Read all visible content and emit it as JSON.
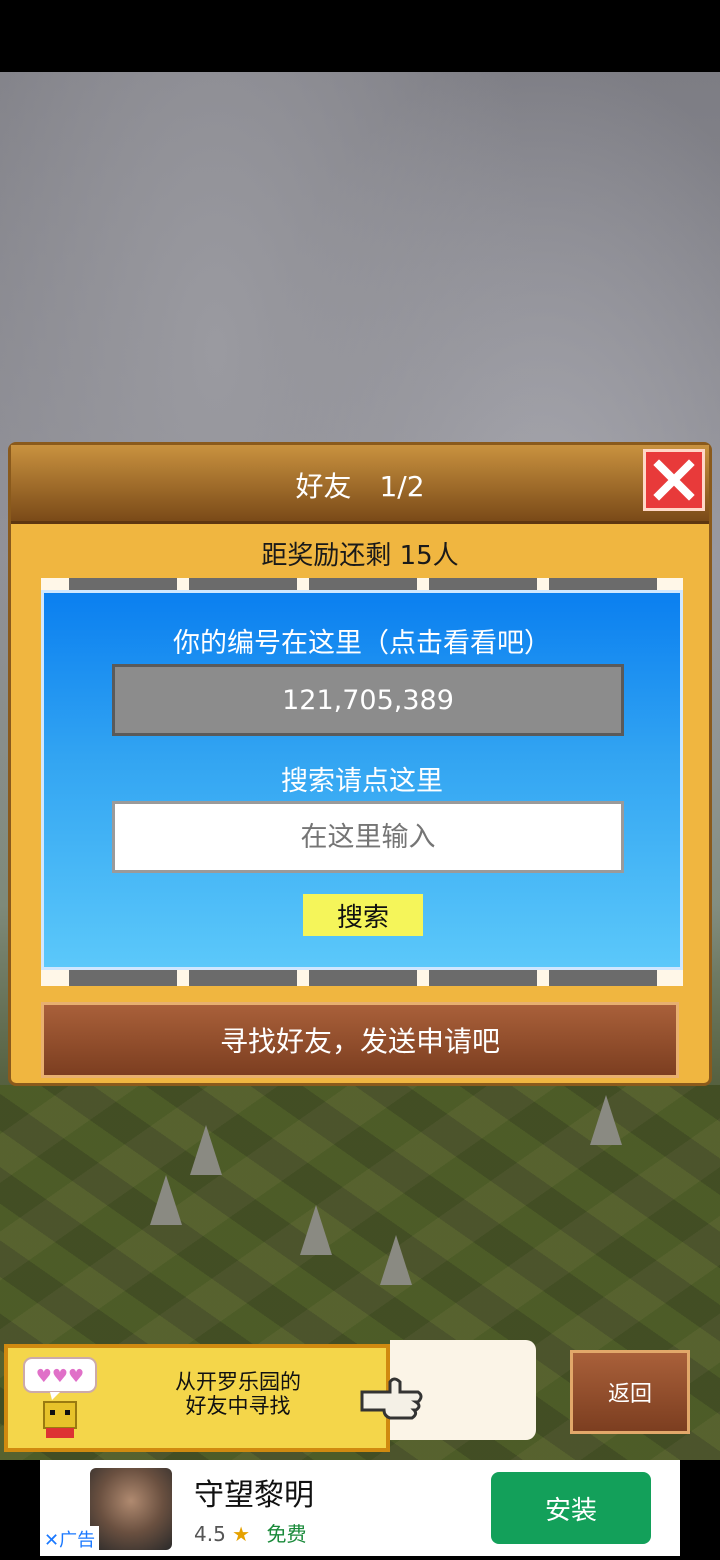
{
  "dialog": {
    "title": "好友　1/2",
    "reward_text": "距奖励还剩 15人",
    "id_label": "你的编号在这里（点击看看吧）",
    "user_id": "121,705,389",
    "search_label": "搜索请点这里",
    "search_placeholder": "在这里输入",
    "search_button": "搜索",
    "find_button": "寻找好友，发送申请吧"
  },
  "kairo": {
    "line1": "从开罗乐园的",
    "line2": "好友中寻找"
  },
  "back_button": "返回",
  "ad": {
    "title": "守望黎明",
    "rating": "4.5",
    "price": "免费",
    "install": "安装",
    "label": "广告"
  },
  "colors": {
    "panel_blue": "#0a7ff0",
    "close_red": "#e83a3a",
    "search_yellow": "#f5f55a",
    "install_green": "#13a05a"
  }
}
